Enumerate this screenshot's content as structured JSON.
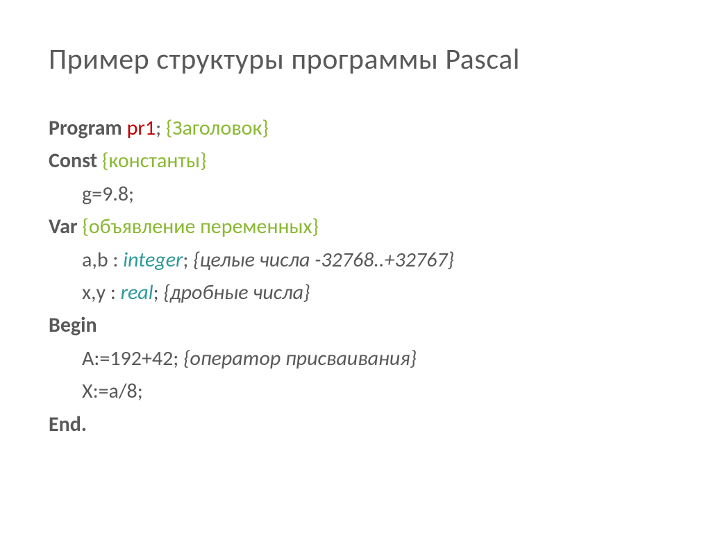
{
  "title": "Пример структуры программы Pascal",
  "code": {
    "l1": {
      "kw": "Program ",
      "name": "pr1",
      "semi": "; ",
      "comment": "{Заголовок}"
    },
    "l2": {
      "kw": "Const ",
      "comment": "{константы}"
    },
    "l3": {
      "text": "g=9.8;"
    },
    "l4": {
      "kw": "Var ",
      "comment": "{объявление переменных}"
    },
    "l5": {
      "pre": "a,b : ",
      "type": "integer",
      "semi": "; ",
      "comment": "{целые числа -32768..+32767}"
    },
    "l6": {
      "pre": "x,y : ",
      "type": "real",
      "semi": "; ",
      "comment": "{дробные числа}"
    },
    "l7": {
      "kw": "Begin"
    },
    "l8": {
      "text": "A:=192+42; ",
      "comment": "{оператор присваивания}"
    },
    "l9": {
      "text": "X:=a/8;"
    },
    "l10": {
      "kw": "End."
    }
  }
}
